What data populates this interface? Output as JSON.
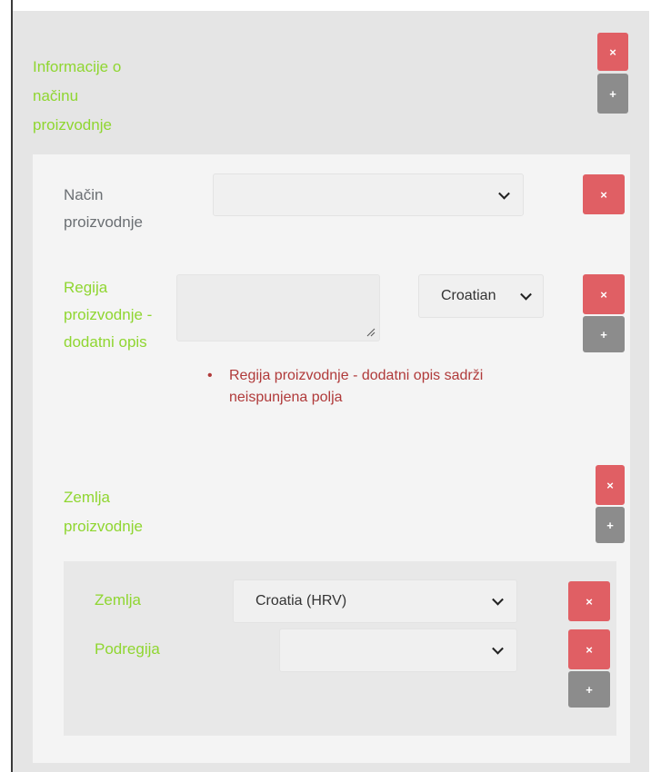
{
  "section": {
    "title": "Informacije o načinu proizvodnje",
    "remove_label": "×",
    "add_label": "+"
  },
  "method": {
    "label": "Način proizvodnje",
    "value": "",
    "remove_label": "×"
  },
  "region_desc": {
    "label": "Regija proizvodnje - dodatni opis",
    "textarea_value": "",
    "language_value": "Croatian",
    "remove_label": "×",
    "add_label": "+",
    "error": "Regija proizvodnje - dodatni opis sadrži neispunjena polja"
  },
  "country_block": {
    "title": "Zemlja proizvodnje",
    "remove_label": "×",
    "add_label": "+",
    "country_label": "Zemlja",
    "country_value": "Croatia (HRV)",
    "country_remove_label": "×",
    "subregion_label": "Podregija",
    "subregion_value": "",
    "subregion_remove_label": "×",
    "subregion_add_label": "+"
  },
  "colors": {
    "green_label": "#8fd630",
    "remove_button": "#e05f64",
    "add_button": "#8c8c8c",
    "error_text": "#b03a3a"
  }
}
